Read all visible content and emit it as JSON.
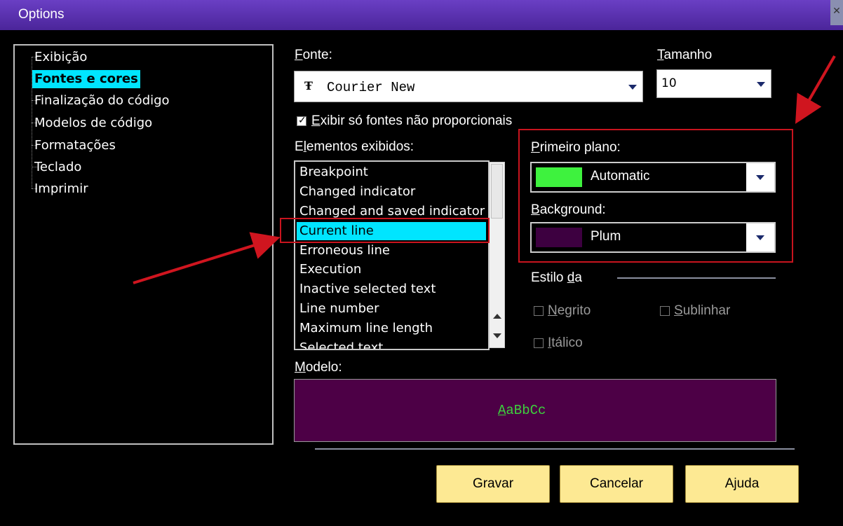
{
  "window": {
    "title": "Options",
    "close_icon": "close-icon"
  },
  "tree": {
    "items": [
      {
        "label": "Exibição",
        "selected": false
      },
      {
        "label": "Fontes e cores",
        "selected": true
      },
      {
        "label": "Finalização do código",
        "selected": false
      },
      {
        "label": "Modelos de código",
        "selected": false
      },
      {
        "label": "Formatações",
        "selected": false
      },
      {
        "label": "Teclado",
        "selected": false
      },
      {
        "label": "Imprimir",
        "selected": false
      }
    ]
  },
  "font": {
    "label_key": "F",
    "label_rest": "onte:",
    "value": "Courier New",
    "icon": "truetype-font-icon"
  },
  "size": {
    "label_key": "T",
    "label_rest": "amanho",
    "value": "10"
  },
  "only_fixed": {
    "checked": true,
    "label_key": "E",
    "label_rest": "xibir só fontes não proporcionais"
  },
  "elements": {
    "label_pre": "E",
    "label_key": "l",
    "label_rest": "ementos exibidos:",
    "items": [
      {
        "label": "Breakpoint",
        "selected": false
      },
      {
        "label": "Changed indicator",
        "selected": false
      },
      {
        "label": "Changed and saved indicator",
        "selected": false
      },
      {
        "label": "Current line",
        "selected": true
      },
      {
        "label": "Erroneous line",
        "selected": false
      },
      {
        "label": "Execution",
        "selected": false
      },
      {
        "label": "Inactive selected text",
        "selected": false
      },
      {
        "label": "Line number",
        "selected": false
      },
      {
        "label": "Maximum line length",
        "selected": false
      },
      {
        "label": "Selected text",
        "selected": false
      }
    ]
  },
  "foreground": {
    "label_key": "P",
    "label_rest": "rimeiro plano:",
    "color_name": "Automatic",
    "swatch": "#3ef23e"
  },
  "background": {
    "label_key": "B",
    "label_rest": "ackground:",
    "color_name": "Plum",
    "swatch": "#3d0040"
  },
  "style": {
    "label_pre": "Estilo ",
    "label_key": "d",
    "label_rest": "a",
    "bold": {
      "label_key": "N",
      "label_rest": "egrito",
      "checked": false
    },
    "underline": {
      "label_key": "S",
      "label_rest": "ublinhar",
      "checked": false
    },
    "italic": {
      "label_key": "I",
      "label_rest": "tálico",
      "checked": false
    }
  },
  "model": {
    "label_key": "M",
    "label_rest": "odelo:",
    "sample_key": "A",
    "sample_rest": "aBbCc",
    "bg": "#4d0046",
    "fg": "#3dd13d"
  },
  "buttons": {
    "save": "Gravar",
    "cancel": "Cancelar",
    "help": "Ajuda"
  },
  "colors": {
    "selection": "#00e5ff",
    "highlight_box": "#c8141e",
    "button_bg": "#fde993",
    "titlebar": "#5a30b0"
  }
}
